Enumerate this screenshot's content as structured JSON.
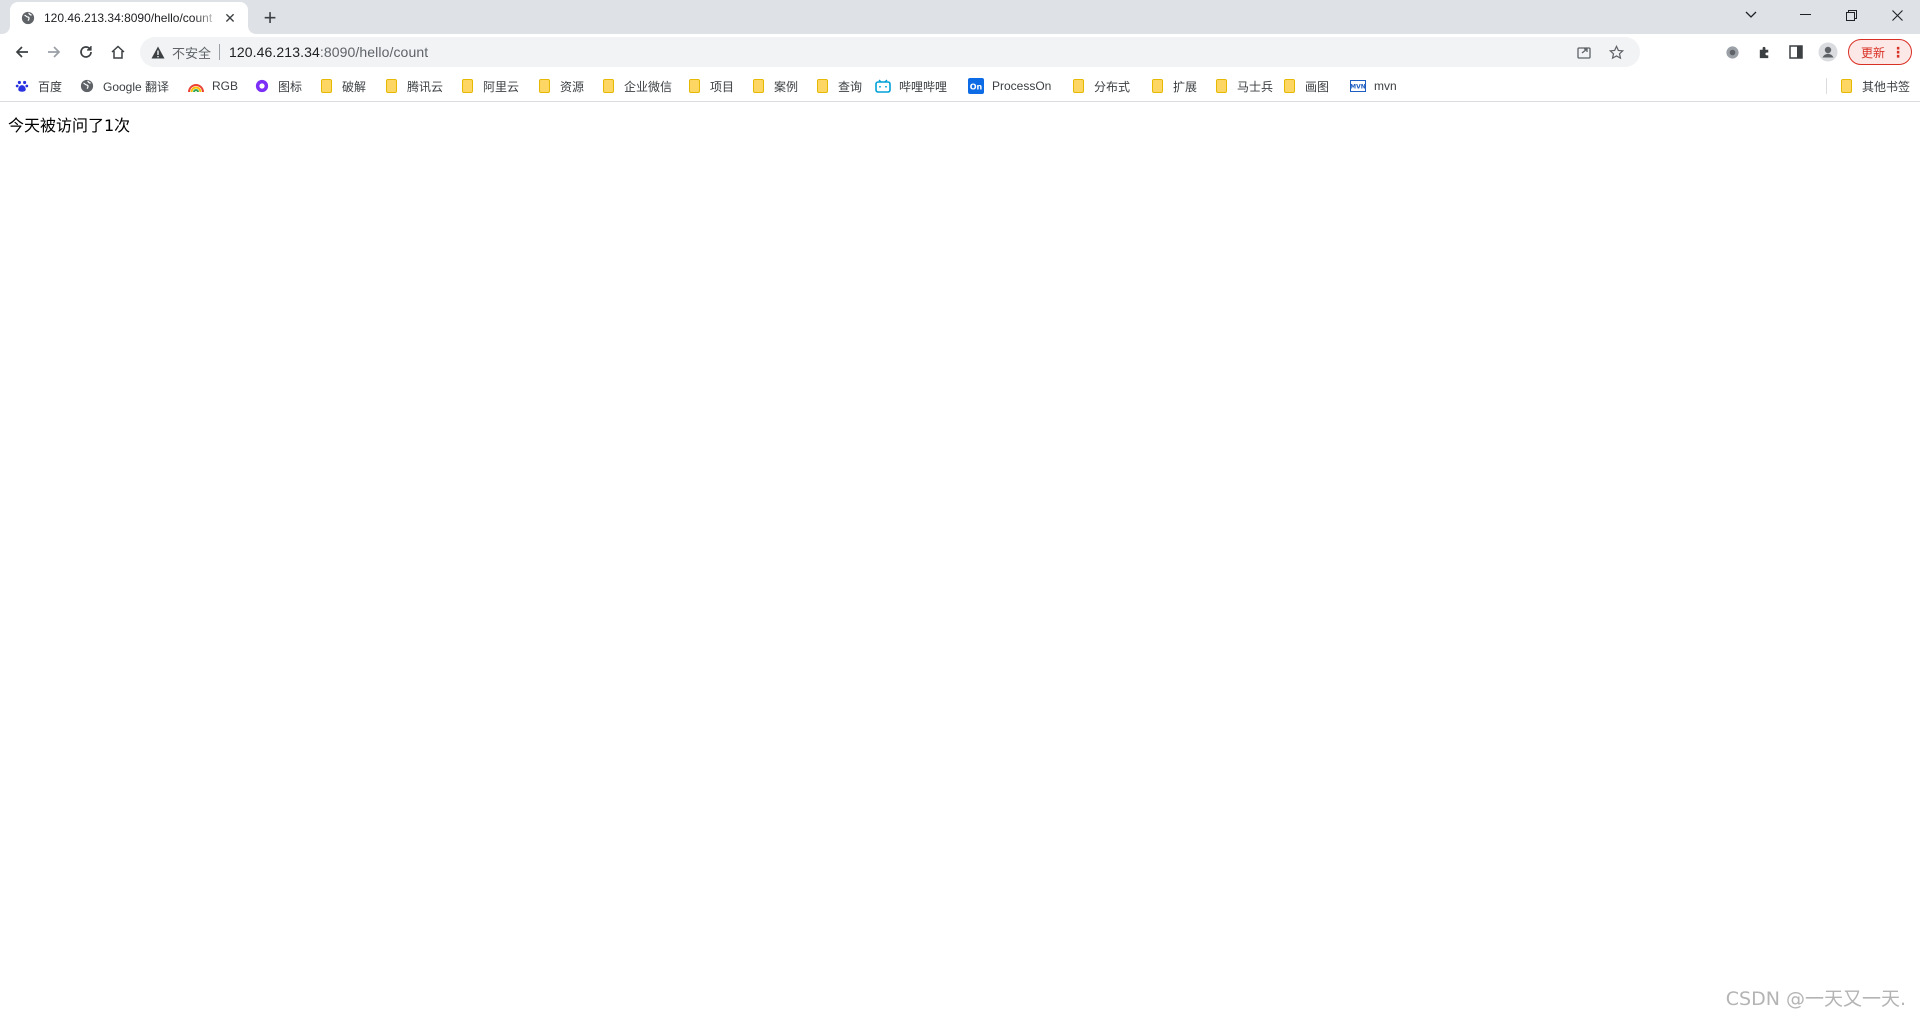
{
  "tab": {
    "title": "120.46.213.34:8090/hello/count",
    "close_glyph": "✕"
  },
  "new_tab_glyph": "+",
  "window": {
    "minimize": "—",
    "maximize": "❐",
    "close": "✕",
    "tab_search": "⌄"
  },
  "omnibox": {
    "security_label": "不安全",
    "url_host": "120.46.213.34",
    "url_rest": ":8090/hello/count"
  },
  "update_button": {
    "label": "更新",
    "menu_glyph": "⋮"
  },
  "bookmarks": [
    {
      "label": "百度",
      "icon": "baidu-icon",
      "color": "#2932e1"
    },
    {
      "label": "Google 翻译",
      "icon": "globe-icon",
      "color": "#5f6368"
    },
    {
      "label": "RGB",
      "icon": "rainbow-icon",
      "color": "#e8710a"
    },
    {
      "label": "图标",
      "icon": "iconfont-icon",
      "color": "#7b2ff7"
    },
    {
      "label": "破解",
      "icon": "folder-icon"
    },
    {
      "label": "腾讯云",
      "icon": "folder-icon"
    },
    {
      "label": "阿里云",
      "icon": "folder-icon"
    },
    {
      "label": "资源",
      "icon": "folder-icon"
    },
    {
      "label": "企业微信",
      "icon": "folder-icon"
    },
    {
      "label": "项目",
      "icon": "folder-icon"
    },
    {
      "label": "案例",
      "icon": "folder-icon"
    },
    {
      "label": "查询",
      "icon": "folder-icon"
    },
    {
      "label": "哔哩哔哩",
      "icon": "bilibili-icon",
      "color": "#00a1d6"
    },
    {
      "label": "ProcessOn",
      "icon": "processon-icon",
      "color": "#0d6be6"
    },
    {
      "label": "分布式",
      "icon": "folder-icon"
    },
    {
      "label": "扩展",
      "icon": "folder-icon"
    },
    {
      "label": "马士兵",
      "icon": "folder-icon"
    },
    {
      "label": "画图",
      "icon": "folder-icon"
    },
    {
      "label": "mvn",
      "icon": "mvn-icon",
      "color": "#1e5ec2"
    }
  ],
  "other_bookmarks": {
    "label": "其他书签",
    "icon": "folder-icon"
  },
  "page": {
    "message": "今天被访问了1次",
    "watermark": "CSDN @一天又一天."
  },
  "colors": {
    "tabstrip": "#dee1e6",
    "omnibox": "#f1f3f4",
    "update": "#d93025",
    "folder": "#fdd663"
  }
}
